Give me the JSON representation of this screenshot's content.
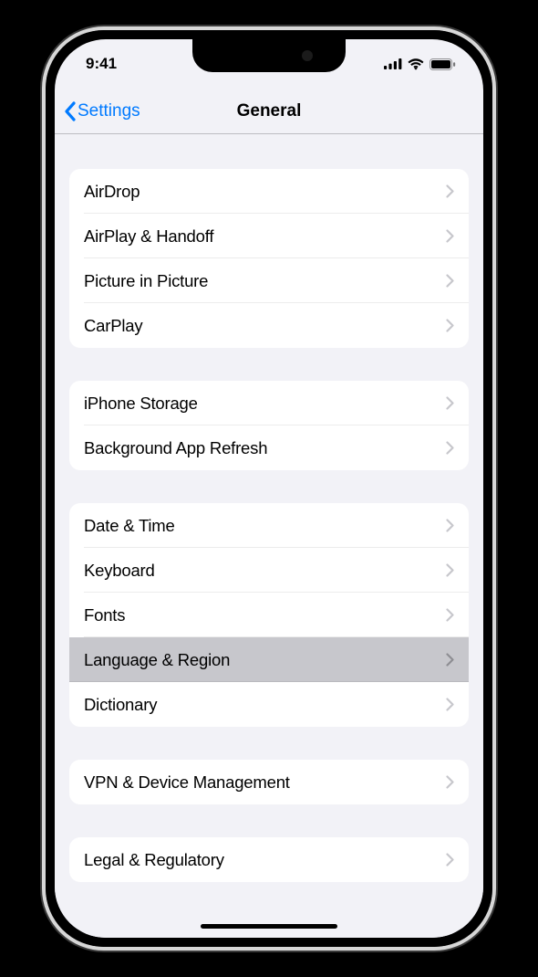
{
  "status": {
    "time": "9:41"
  },
  "nav": {
    "back_label": "Settings",
    "title": "General"
  },
  "groups": [
    {
      "rows": [
        {
          "label": "AirDrop",
          "selected": false
        },
        {
          "label": "AirPlay & Handoff",
          "selected": false
        },
        {
          "label": "Picture in Picture",
          "selected": false
        },
        {
          "label": "CarPlay",
          "selected": false
        }
      ]
    },
    {
      "rows": [
        {
          "label": "iPhone Storage",
          "selected": false
        },
        {
          "label": "Background App Refresh",
          "selected": false
        }
      ]
    },
    {
      "rows": [
        {
          "label": "Date & Time",
          "selected": false
        },
        {
          "label": "Keyboard",
          "selected": false
        },
        {
          "label": "Fonts",
          "selected": false
        },
        {
          "label": "Language & Region",
          "selected": true
        },
        {
          "label": "Dictionary",
          "selected": false
        }
      ]
    },
    {
      "rows": [
        {
          "label": "VPN & Device Management",
          "selected": false
        }
      ]
    },
    {
      "rows": [
        {
          "label": "Legal & Regulatory",
          "selected": false
        }
      ]
    }
  ]
}
